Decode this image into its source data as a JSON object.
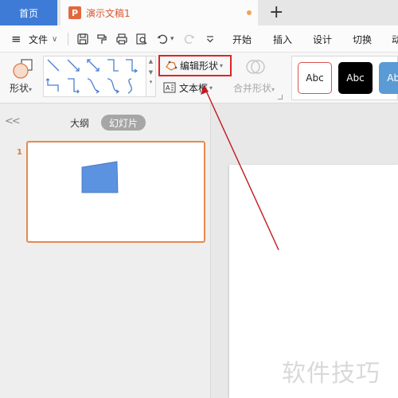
{
  "tabs": {
    "home_label": "首页",
    "doc_icon_glyph": "P",
    "doc_title": "演示文稿1",
    "add_label": "+"
  },
  "menu": {
    "hamburger": "≡",
    "file_label": "文件",
    "file_chevron": "∨",
    "items": [
      "开始",
      "插入",
      "设计",
      "切换",
      "动"
    ]
  },
  "ribbon": {
    "shape_label": "形状",
    "edit_shape_label": "编辑形状",
    "textbox_label": "文本框",
    "merge_label": "合并形状",
    "dropdown_caret": "▾",
    "style_swatches": [
      {
        "label": "Abc",
        "bg": "#ffffff",
        "fg": "#222222",
        "border": "#d9534f"
      },
      {
        "label": "Abc",
        "bg": "#000000",
        "fg": "#ffffff",
        "border": "#000000"
      },
      {
        "label": "Abc",
        "bg": "#5b9bd5",
        "fg": "#ffffff",
        "border": "#5b9bd5"
      }
    ]
  },
  "panel": {
    "collapse_glyph": "<<",
    "outline_tab": "大纲",
    "slides_tab": "幻灯片",
    "slide_number": "1"
  },
  "canvas": {
    "watermark": "软件技巧"
  },
  "colors": {
    "accent_blue": "#3d7bd6",
    "ppt_orange": "#e2683e",
    "highlight_red": "#e02424",
    "arrow_red": "#c0191f",
    "shape_fill": "#5b93e0"
  }
}
